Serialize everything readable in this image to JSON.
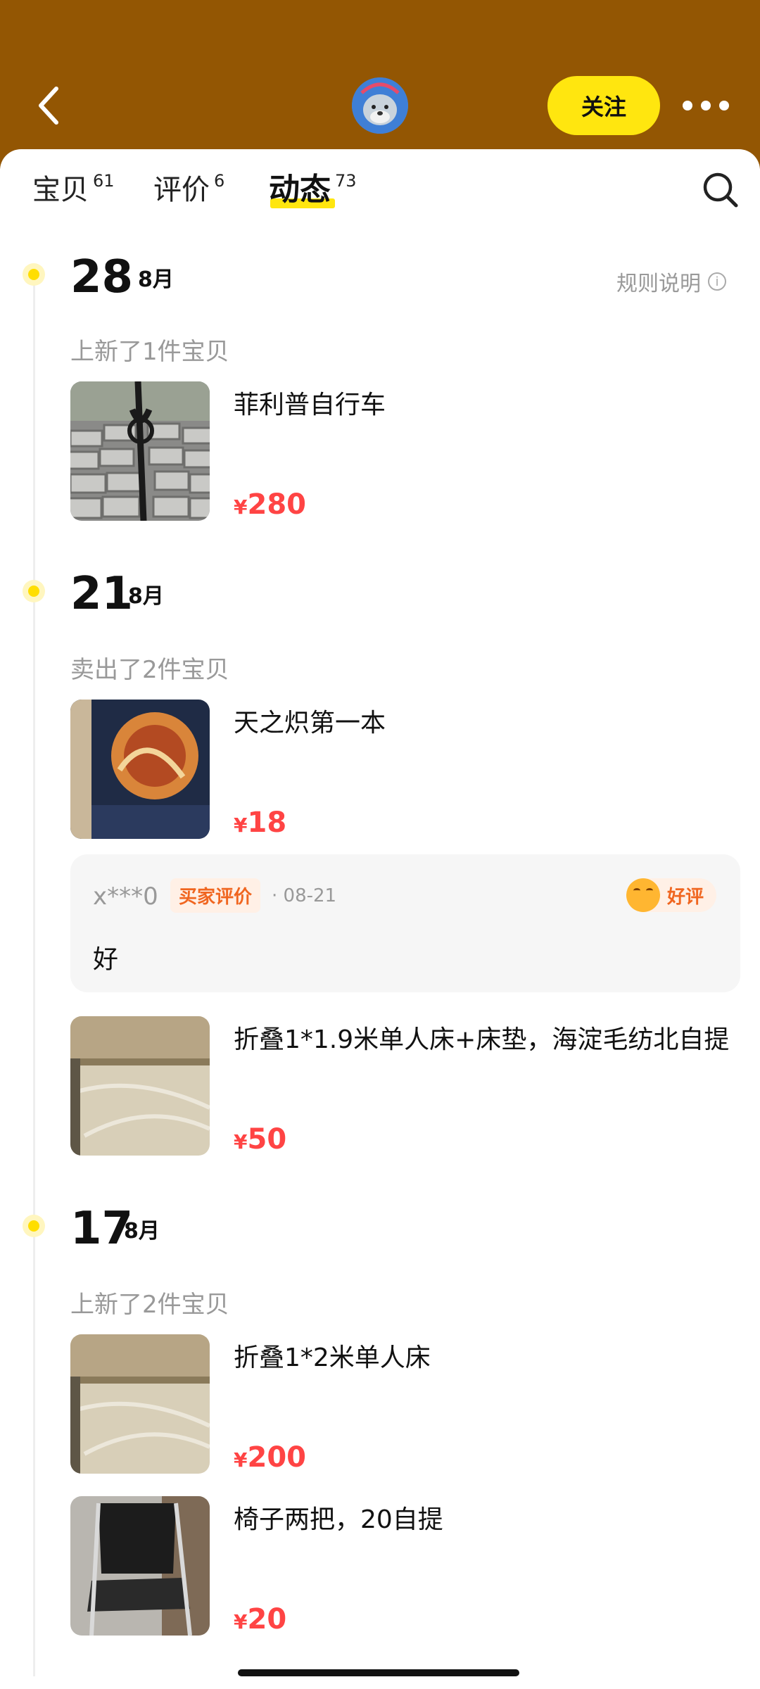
{
  "header": {
    "follow_label": "关注",
    "brand_color": "#935603",
    "accent_color": "#ffe60f"
  },
  "tabs": [
    {
      "label": "宝贝",
      "count": "61",
      "active": false
    },
    {
      "label": "评价",
      "count": "6",
      "active": false
    },
    {
      "label": "动态",
      "count": "73",
      "active": true
    }
  ],
  "rules_label": "规则说明",
  "timeline": [
    {
      "day": "28",
      "month": "8月",
      "groups": [
        {
          "title": "上新了1件宝贝",
          "items": [
            {
              "title": "菲利普自行车",
              "currency": "¥",
              "price": "280"
            }
          ]
        }
      ]
    },
    {
      "day": "21",
      "month": "8月",
      "groups": [
        {
          "title": "卖出了2件宝贝",
          "items": [
            {
              "title": "天之炽第一本",
              "currency": "¥",
              "price": "18",
              "review": {
                "user": "x***0",
                "tag": "买家评价",
                "date": "· 08-21",
                "badge": "好评",
                "text": "好"
              }
            },
            {
              "title": "折叠1*1.9米单人床+床垫，海淀毛纺北自提",
              "currency": "¥",
              "price": "50"
            }
          ]
        }
      ]
    },
    {
      "day": "17",
      "month": "8月",
      "groups": [
        {
          "title": "上新了2件宝贝",
          "items": [
            {
              "title": "折叠1*2米单人床",
              "currency": "¥",
              "price": "200"
            },
            {
              "title": "椅子两把，20自提",
              "currency": "¥",
              "price": "20"
            }
          ]
        }
      ]
    }
  ],
  "price_color": "#ff4444"
}
